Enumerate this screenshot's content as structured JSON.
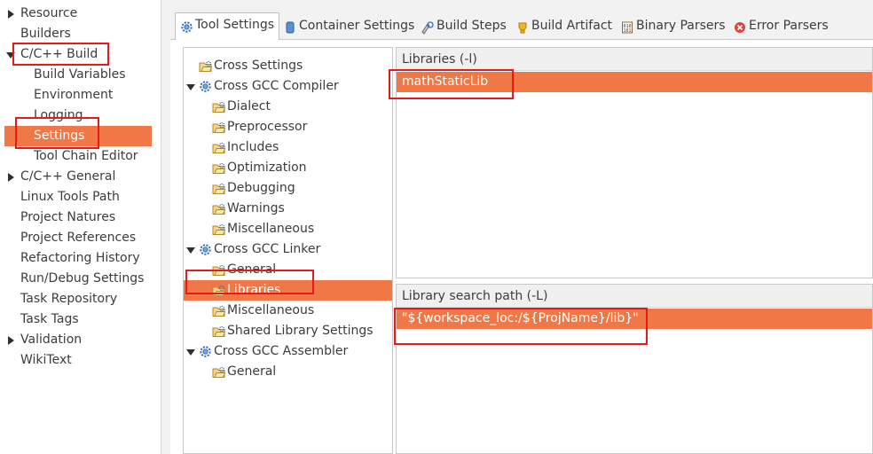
{
  "left_nav": {
    "items": [
      {
        "label": "Resource",
        "expander": "closed"
      },
      {
        "label": "Builders",
        "expander": "none"
      },
      {
        "label": "C/C++ Build",
        "expander": "open"
      },
      {
        "label": "Build Variables",
        "expander": "none",
        "child": true
      },
      {
        "label": "Environment",
        "expander": "none",
        "child": true
      },
      {
        "label": "Logging",
        "expander": "none",
        "child": true
      },
      {
        "label": "Settings",
        "expander": "none",
        "child": true,
        "selected": true
      },
      {
        "label": "Tool Chain Editor",
        "expander": "none",
        "child": true
      },
      {
        "label": "C/C++ General",
        "expander": "closed"
      },
      {
        "label": "Linux Tools Path",
        "expander": "none"
      },
      {
        "label": "Project Natures",
        "expander": "none"
      },
      {
        "label": "Project References",
        "expander": "none"
      },
      {
        "label": "Refactoring History",
        "expander": "none"
      },
      {
        "label": "Run/Debug Settings",
        "expander": "none"
      },
      {
        "label": "Task Repository",
        "expander": "none"
      },
      {
        "label": "Task Tags",
        "expander": "none"
      },
      {
        "label": "Validation",
        "expander": "closed"
      },
      {
        "label": "WikiText",
        "expander": "none"
      }
    ]
  },
  "tabs": [
    {
      "label": "Tool Settings",
      "icon": "tool-settings-icon",
      "active": true
    },
    {
      "label": "Container Settings",
      "icon": "container-icon"
    },
    {
      "label": "Build Steps",
      "icon": "build-steps-icon"
    },
    {
      "label": "Build Artifact",
      "icon": "trophy-icon"
    },
    {
      "label": "Binary Parsers",
      "icon": "binary-icon"
    },
    {
      "label": "Error Parsers",
      "icon": "error-icon"
    }
  ],
  "tool_tree": {
    "items": [
      {
        "label": "Cross Settings",
        "kind": "option",
        "level": 0
      },
      {
        "label": "Cross GCC Compiler",
        "kind": "tool",
        "level": 0
      },
      {
        "label": "Dialect",
        "kind": "option",
        "level": 1
      },
      {
        "label": "Preprocessor",
        "kind": "option",
        "level": 1
      },
      {
        "label": "Includes",
        "kind": "option",
        "level": 1
      },
      {
        "label": "Optimization",
        "kind": "option",
        "level": 1
      },
      {
        "label": "Debugging",
        "kind": "option",
        "level": 1
      },
      {
        "label": "Warnings",
        "kind": "option",
        "level": 1
      },
      {
        "label": "Miscellaneous",
        "kind": "option",
        "level": 1
      },
      {
        "label": "Cross GCC Linker",
        "kind": "tool",
        "level": 0
      },
      {
        "label": "General",
        "kind": "option",
        "level": 1
      },
      {
        "label": "Libraries",
        "kind": "option",
        "level": 1,
        "selected": true
      },
      {
        "label": "Miscellaneous",
        "kind": "option",
        "level": 1
      },
      {
        "label": "Shared Library Settings",
        "kind": "option",
        "level": 1
      },
      {
        "label": "Cross GCC Assembler",
        "kind": "tool",
        "level": 0
      },
      {
        "label": "General",
        "kind": "option",
        "level": 1
      }
    ]
  },
  "libraries_panel": {
    "title": "Libraries (-l)",
    "items": [
      "mathStaticLib"
    ]
  },
  "search_path_panel": {
    "title": "Library search path (-L)",
    "items": [
      "\"${workspace_loc:/${ProjName}/lib}\""
    ]
  },
  "colors": {
    "selection": "#f07846",
    "highlight_box": "#e8191a"
  }
}
